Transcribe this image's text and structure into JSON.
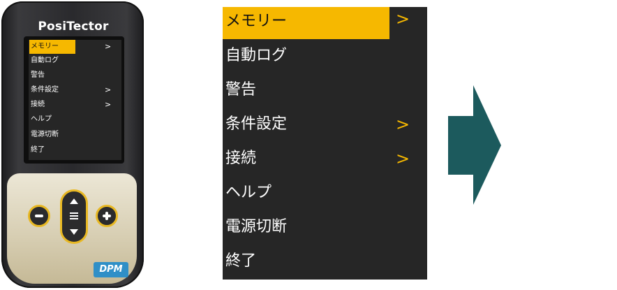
{
  "device": {
    "brand": "PosiTector",
    "model": "DPM",
    "colors": {
      "accent": "#f6b800",
      "button_ring": "#e8b823",
      "badge": "#2f8fc7",
      "body": "#2a2a2d"
    },
    "mini_menu": [
      {
        "label": "メモリー",
        "chevron": ">",
        "selected": true
      },
      {
        "label": "自動ログ",
        "chevron": ""
      },
      {
        "label": "警告",
        "chevron": ""
      },
      {
        "label": "条件設定",
        "chevron": ">"
      },
      {
        "label": "接続",
        "chevron": ">"
      },
      {
        "label": "ヘルプ",
        "chevron": ""
      },
      {
        "label": "電源切断",
        "chevron": ""
      },
      {
        "label": "終了",
        "chevron": ""
      }
    ],
    "buttons": {
      "minus_icon": "minus-icon",
      "menu_icon": "menu-icon",
      "plus_icon": "plus-icon"
    }
  },
  "menu": {
    "items": [
      {
        "label": "メモリー",
        "chevron": ">",
        "selected": true
      },
      {
        "label": "自動ログ",
        "chevron": ""
      },
      {
        "label": "警告",
        "chevron": ""
      },
      {
        "label": "条件設定",
        "chevron": ">"
      },
      {
        "label": "接続",
        "chevron": ">"
      },
      {
        "label": "ヘルプ",
        "chevron": ""
      },
      {
        "label": "電源切断",
        "chevron": ""
      },
      {
        "label": "終了",
        "chevron": ""
      }
    ],
    "colors": {
      "background": "#262626",
      "highlight": "#f6b800",
      "text": "#ffffff"
    }
  },
  "arrow": {
    "icon": "right-arrow-icon",
    "color": "#1c5a5d"
  }
}
